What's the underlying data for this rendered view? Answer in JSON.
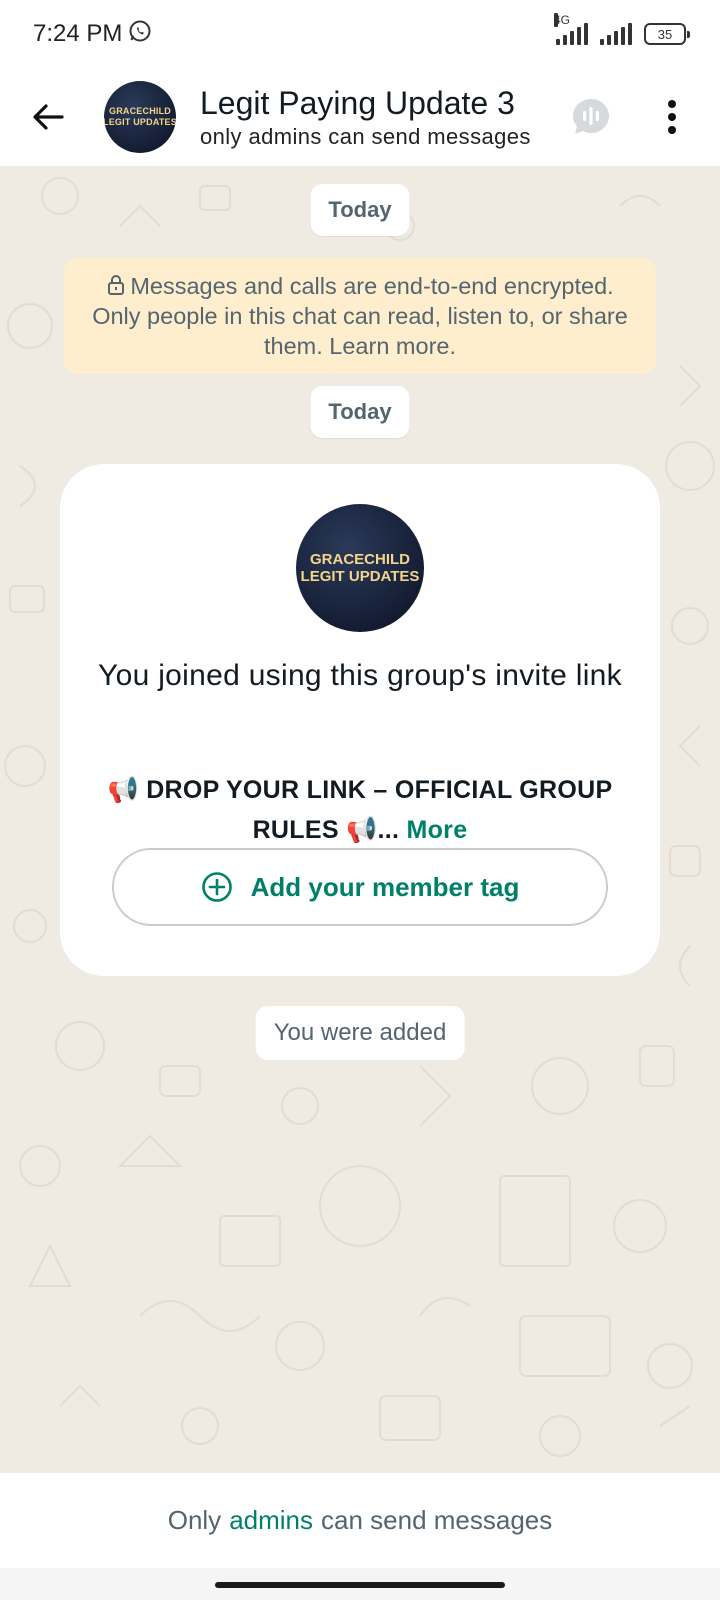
{
  "status_bar": {
    "time": "7:24 PM",
    "network_type": "4G",
    "battery_level": "35",
    "icons": [
      "whatsapp-icon",
      "signal-icon",
      "signal-icon",
      "battery-icon"
    ]
  },
  "header": {
    "title": "Legit Paying Update 3",
    "subtitle": "only admins can send messages",
    "avatar_text": [
      "GRACECHILD",
      "LEGIT UPDATES"
    ]
  },
  "chat": {
    "date_chip_1": "Today",
    "encryption_notice": "Messages and calls are end-to-end encrypted. Only people in this chat can read, listen to, or share them. Learn more.",
    "date_chip_2": "Today",
    "invite_card": {
      "avatar_text": [
        "GRACECHILD",
        "LEGIT UPDATES"
      ],
      "title": "You joined using this group's invite link",
      "description": "📢 DROP YOUR LINK – OFFICIAL GROUP RULES 📢...",
      "more_label": "More",
      "member_tag_label": "Add your member tag"
    },
    "system_message": "You were added"
  },
  "footer": {
    "prefix": "Only",
    "admins_link": "admins",
    "suffix": "can send messages"
  },
  "colors": {
    "accent": "#008069",
    "chat_bg": "#efeae2",
    "notice_bg": "#ffeecd",
    "secondary_text": "#54656f"
  }
}
